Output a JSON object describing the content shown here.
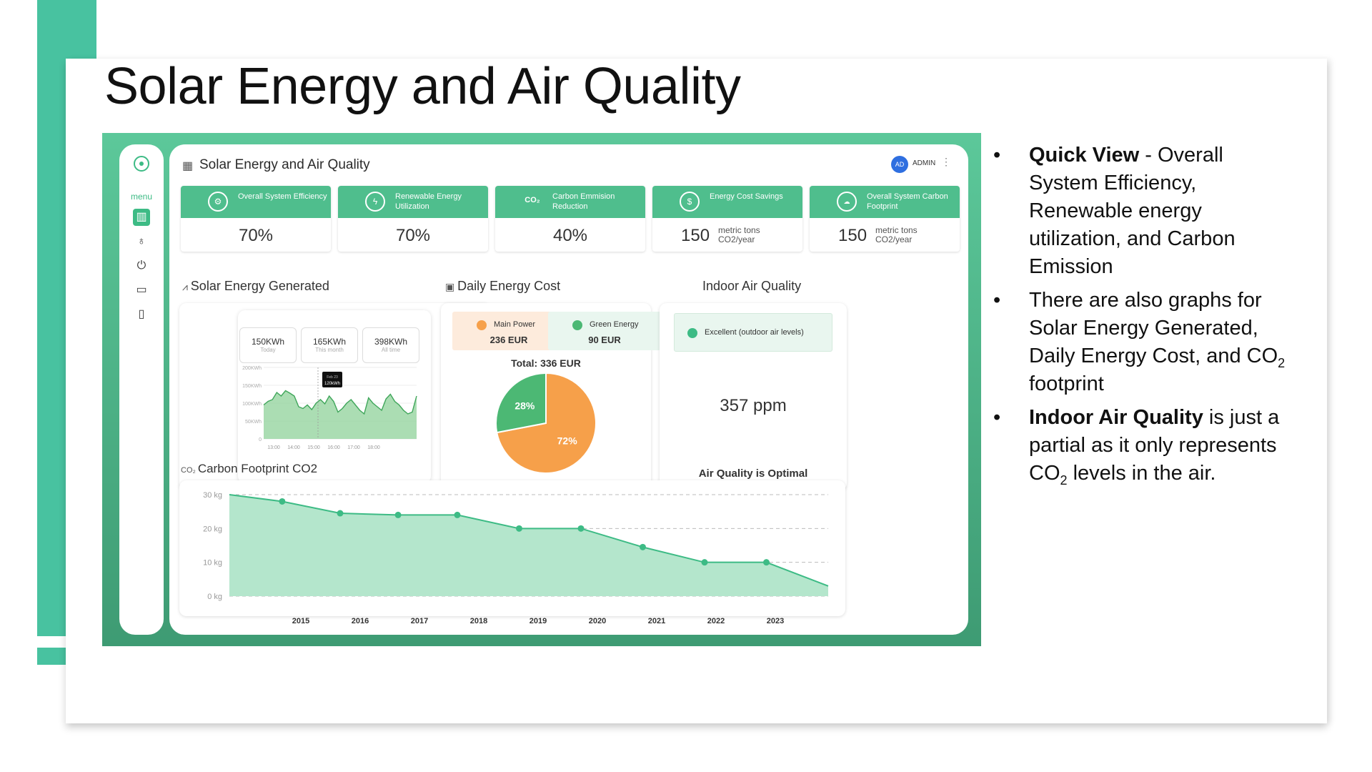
{
  "slide": {
    "title": "Solar Energy and Air Quality",
    "accent_color": "#48c2a0"
  },
  "dashboard": {
    "title": "Solar Energy and Air Quality",
    "sidebar": {
      "menu_label": "menu",
      "items": [
        "dashboard-icon",
        "lightbulb-icon",
        "power-icon",
        "monitor-chart-icon",
        "battery-icon"
      ]
    },
    "user": {
      "initials": "AD",
      "label": "ADMIN"
    },
    "kpis": [
      {
        "label": "Overall System Efficiency",
        "value": "70%",
        "unit": "",
        "icon": "gear-icon"
      },
      {
        "label": "Renewable Energy Utilization",
        "value": "70%",
        "unit": "",
        "icon": "lightning-icon"
      },
      {
        "label": "Carbon Emmision Reduction",
        "value": "40%",
        "unit": "",
        "icon": "co2-icon",
        "icon_text": "CO₂"
      },
      {
        "label": "Energy Cost Savings",
        "value": "150",
        "unit": "metric tons CO2/year",
        "icon": "dollar-icon"
      },
      {
        "label": "Overall System Carbon Footprint",
        "value": "150",
        "unit": "metric tons CO2/year",
        "icon": "co2-cloud-icon"
      }
    ],
    "solar": {
      "title": "Solar Energy Generated",
      "stats": [
        {
          "value": "150KWh",
          "label": "Today"
        },
        {
          "value": "165KWh",
          "label": "This month"
        },
        {
          "value": "398KWh",
          "label": "All time"
        }
      ],
      "tooltip": {
        "date": "Feb 23",
        "value": "120kWh"
      }
    },
    "cost": {
      "title": "Daily Energy Cost",
      "main_power": {
        "label": "Main Power",
        "value": "236 EUR"
      },
      "green_energy": {
        "label": "Green Energy",
        "value": "90 EUR"
      },
      "total": "Total: 336 EUR"
    },
    "air": {
      "title": "Indoor Air Quality",
      "badge": "Excellent (outdoor air levels)",
      "value": "357 ppm",
      "status": "Air Quality is Optimal"
    },
    "footprint": {
      "title": "Carbon Footprint CO2"
    }
  },
  "bullets": {
    "b1_bold": "Quick View",
    "b1_text": " - Overall System Efficiency, Renewable energy utilization, and Carbon Emission",
    "b2_pre": "There are also graphs for Solar Energy Generated, Daily Energy Cost, and CO",
    "b2_sub": "2",
    "b2_post": " footprint",
    "b3_bold": "Indoor Air Quality",
    "b3_pre": " is just a partial as it only represents CO",
    "b3_sub": "2",
    "b3_post": " levels in the air."
  },
  "chart_data": [
    {
      "type": "area",
      "title": "Solar Energy Generated",
      "x": [
        "13:00",
        "14:00",
        "15:00",
        "16:00",
        "17:00",
        "18:00"
      ],
      "yticks": [
        "0",
        "50KWh",
        "100KWh",
        "150KWh",
        "200KWh"
      ],
      "ylim": [
        0,
        200
      ],
      "series": [
        {
          "values": [
            95,
            105,
            110,
            130,
            120,
            135,
            128,
            120,
            90,
            85,
            95,
            82,
            100,
            110,
            98,
            120,
            105,
            75,
            85,
            100,
            110,
            95,
            80,
            70,
            115,
            100,
            90,
            80,
            112,
            125,
            105,
            95,
            80,
            70,
            75,
            120
          ]
        }
      ],
      "color": "#5cbf73"
    },
    {
      "type": "pie",
      "categories": [
        "Main Power",
        "Green Energy"
      ],
      "values": [
        72,
        28
      ],
      "labels": [
        "72%",
        "28%"
      ],
      "colors": [
        "#f6a04a",
        "#4cb874"
      ]
    },
    {
      "type": "area",
      "title": "Carbon Footprint CO2",
      "x": [
        "2015",
        "2016",
        "2017",
        "2018",
        "2019",
        "2020",
        "2021",
        "2022",
        "2023"
      ],
      "yticks": [
        "0 kg",
        "10 kg",
        "20 kg",
        "30 kg"
      ],
      "ylim": [
        0,
        30
      ],
      "series": [
        {
          "values": [
            30,
            28,
            24.5,
            24,
            24,
            20,
            20,
            14.5,
            10,
            10,
            3
          ]
        }
      ],
      "grid": true,
      "color": "#4cbf86"
    }
  ]
}
